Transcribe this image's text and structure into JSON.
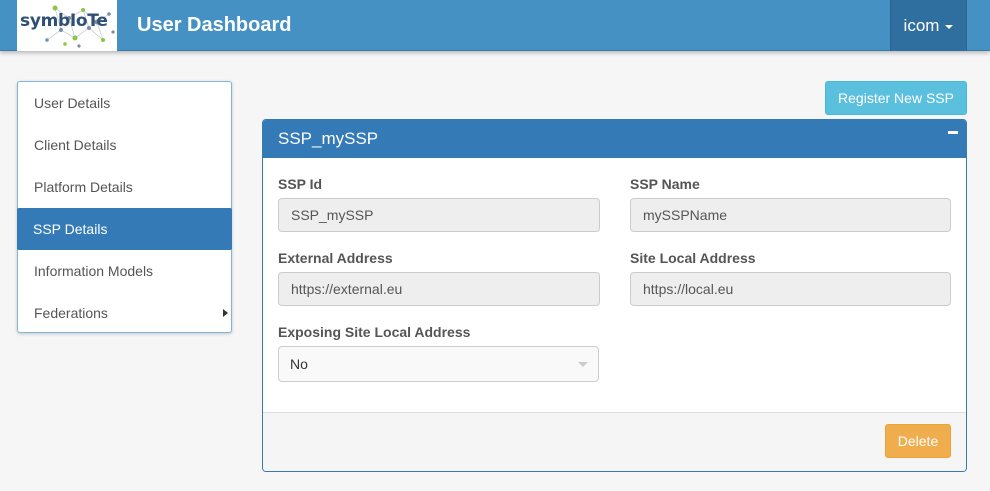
{
  "header": {
    "logo_text": "symbIoTe",
    "title": "User Dashboard",
    "user": "icom"
  },
  "sidebar": {
    "items": [
      {
        "label": "User Details"
      },
      {
        "label": "Client Details"
      },
      {
        "label": "Platform Details"
      },
      {
        "label": "SSP Details",
        "active": true
      },
      {
        "label": "Information Models"
      },
      {
        "label": "Federations",
        "submenu": true
      }
    ]
  },
  "actions": {
    "register_label": "Register New SSP"
  },
  "panel": {
    "title": "SSP_mySSP",
    "ssp_id": {
      "label": "SSP Id",
      "value": "SSP_mySSP"
    },
    "ssp_name": {
      "label": "SSP Name",
      "value": "mySSPName"
    },
    "external_address": {
      "label": "External Address",
      "value": "https://external.eu"
    },
    "site_local_address": {
      "label": "Site Local Address",
      "value": "https://local.eu"
    },
    "exposing": {
      "label": "Exposing Site Local Address",
      "value": "No"
    },
    "delete_label": "Delete"
  },
  "colors": {
    "navbar": "#4691c3",
    "primary": "#337ab7",
    "info": "#5bc0de",
    "warning": "#f0ad4e"
  }
}
